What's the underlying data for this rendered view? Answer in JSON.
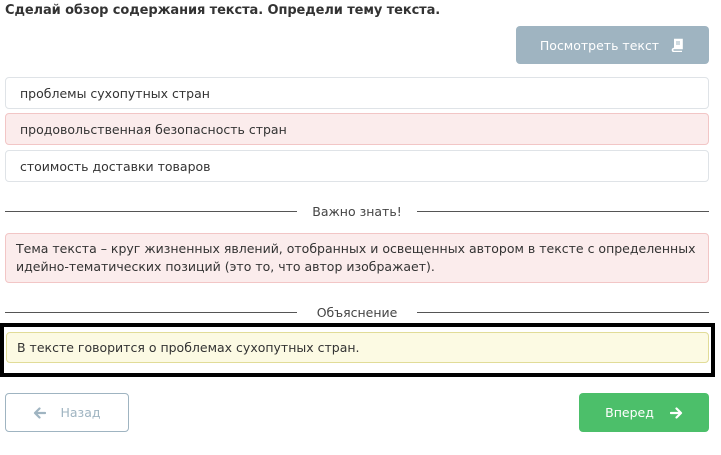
{
  "task": {
    "question": "Сделай обзор содержания текста. Определи тему текста."
  },
  "toolbar": {
    "view_text_label": "Посмотреть текст",
    "view_text_icon": "book-icon"
  },
  "options": [
    {
      "label": "проблемы сухопутных стран",
      "state": "neutral"
    },
    {
      "label": "продовольственная безопасность стран",
      "state": "wrong"
    },
    {
      "label": "стоимость доставки товаров",
      "state": "neutral"
    }
  ],
  "important": {
    "heading": "Важно знать!",
    "text": "Тема текста – круг жизненных явлений, отобранных и освещенных автором в тексте с определенных идейно-тематических позиций (это то, что автор изображает)."
  },
  "explanation": {
    "heading": "Объяснение",
    "text": "В тексте говорится о проблемах сухопутных стран."
  },
  "navigation": {
    "back_label": "Назад",
    "next_label": "Вперед",
    "back_icon": "arrow-left-icon",
    "next_icon": "arrow-right-icon"
  },
  "colors": {
    "accent_disabled": "#9fb4c1",
    "next_green": "#4cbf6a",
    "wrong_bg": "#fbecec",
    "explanation_bg": "#fcfae3"
  }
}
